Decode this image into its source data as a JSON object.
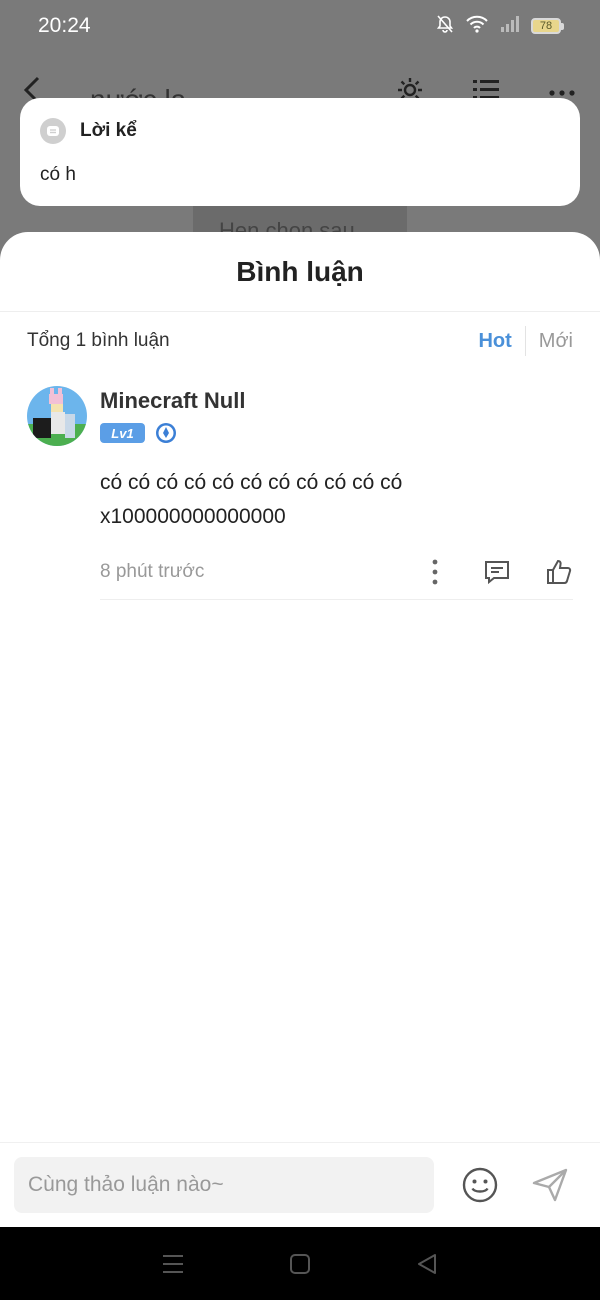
{
  "status": {
    "time": "20:24",
    "battery": "78"
  },
  "header": {
    "title": "nước la"
  },
  "background": {
    "chip_text": "Hẹn chọn sau"
  },
  "toast": {
    "title": "Lời kể",
    "text": "có h"
  },
  "sheet": {
    "title": "Bình luận",
    "total": "Tổng 1 bình luận",
    "sort": {
      "hot": "Hot",
      "new": "Mới"
    }
  },
  "comments": [
    {
      "user": "Minecraft Null",
      "level": "Lv1",
      "text": "có có có có có có có có có có có x100000000000000",
      "time": "8 phút trước"
    }
  ],
  "input": {
    "placeholder": "Cùng thảo luận nào~"
  },
  "colors": {
    "accent": "#4a90d9",
    "level_badge": "#5b9ee6",
    "overlay": "#7a7a7a"
  }
}
